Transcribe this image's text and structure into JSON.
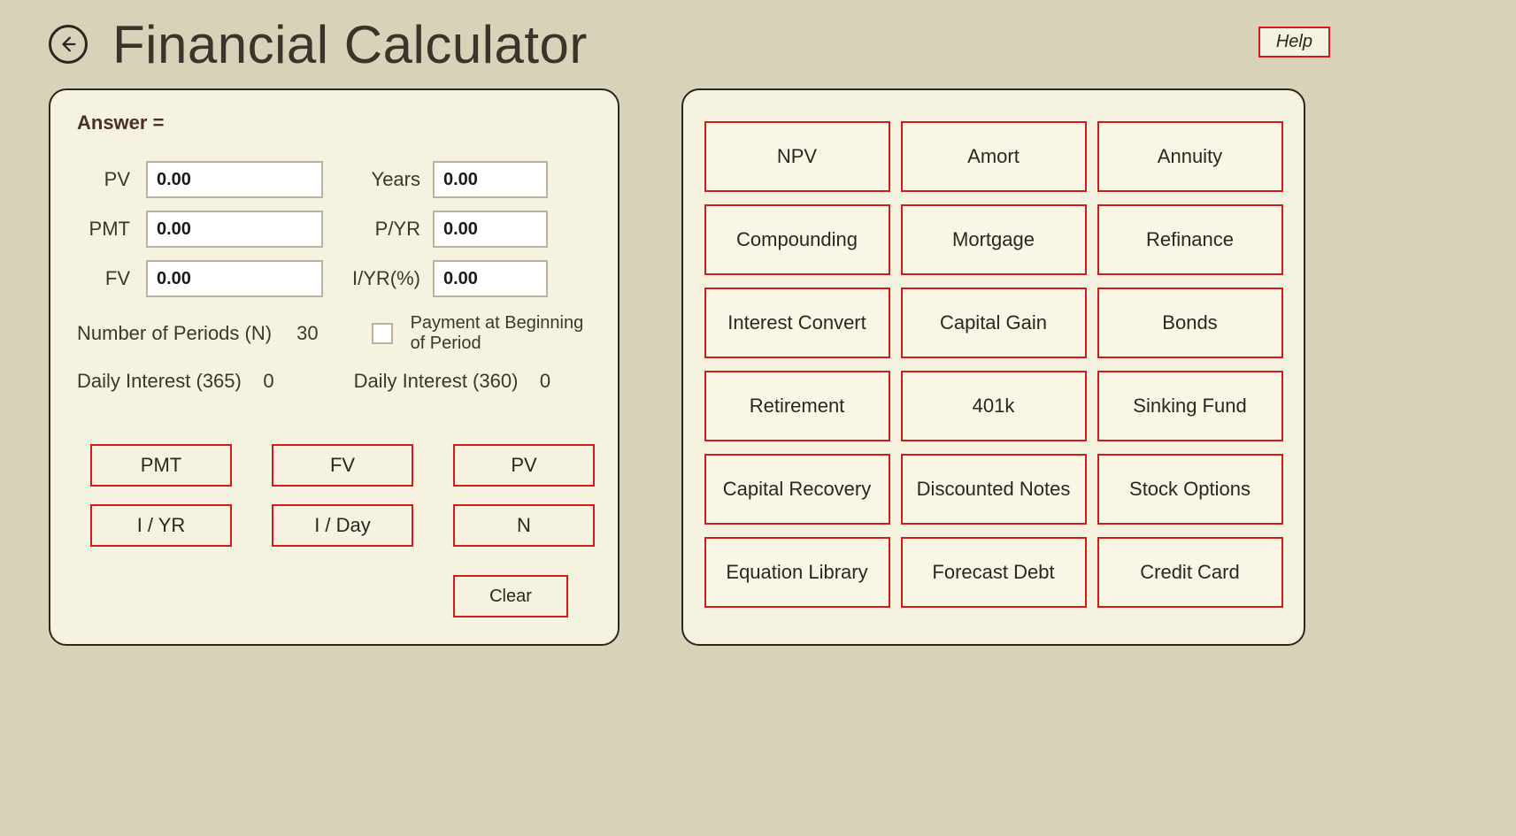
{
  "header": {
    "title": "Financial Calculator",
    "help_label": "Help"
  },
  "answer_label": "Answer =",
  "fields": {
    "pv_label": "PV",
    "pv_value": "0.00",
    "pmt_label": "PMT",
    "pmt_value": "0.00",
    "fv_label": "FV",
    "fv_value": "0.00",
    "years_label": "Years",
    "years_value": "0.00",
    "pyr_label": "P/YR",
    "pyr_value": "0.00",
    "iyr_label": "I/YR(%)",
    "iyr_value": "0.00"
  },
  "info": {
    "periods_label": "Number of Periods  (N)",
    "periods_value": "30",
    "begin_label": "Payment at Beginning of Period",
    "daily365_label": "Daily Interest (365)",
    "daily365_value": "0",
    "daily360_label": "Daily Interest (360)",
    "daily360_value": "0"
  },
  "calc_buttons": [
    "PMT",
    "FV",
    "PV",
    "I / YR",
    "I / Day",
    "N"
  ],
  "clear_label": "Clear",
  "functions": [
    "NPV",
    "Amort",
    "Annuity",
    "Compounding",
    "Mortgage",
    "Refinance",
    "Interest Convert",
    "Capital Gain",
    "Bonds",
    "Retirement",
    "401k",
    "Sinking Fund",
    "Capital Recovery",
    "Discounted Notes",
    "Stock Options",
    "Equation Library",
    "Forecast Debt",
    "Credit Card"
  ]
}
